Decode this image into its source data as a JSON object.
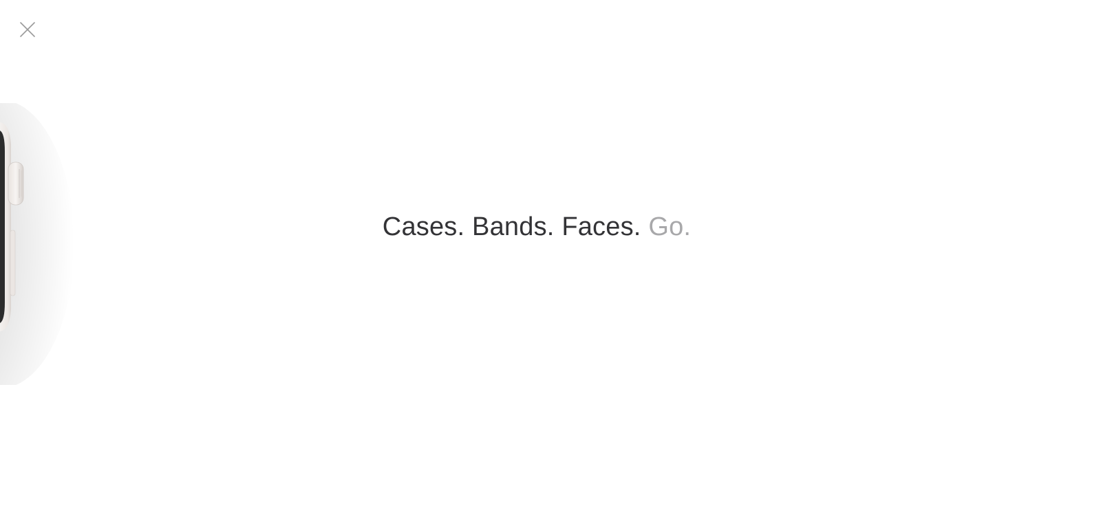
{
  "close": {
    "icon": "close-icon"
  },
  "product_image": {
    "icon": "watch-image"
  },
  "tagline": {
    "part1": "Cases.",
    "part2": "Bands.",
    "part3": "Faces.",
    "part4": "Go."
  },
  "colors": {
    "background": "#ffffff",
    "tagline_primary": "#333336",
    "tagline_muted": "#a8a8aa",
    "close_icon": "#9a9a9a"
  }
}
